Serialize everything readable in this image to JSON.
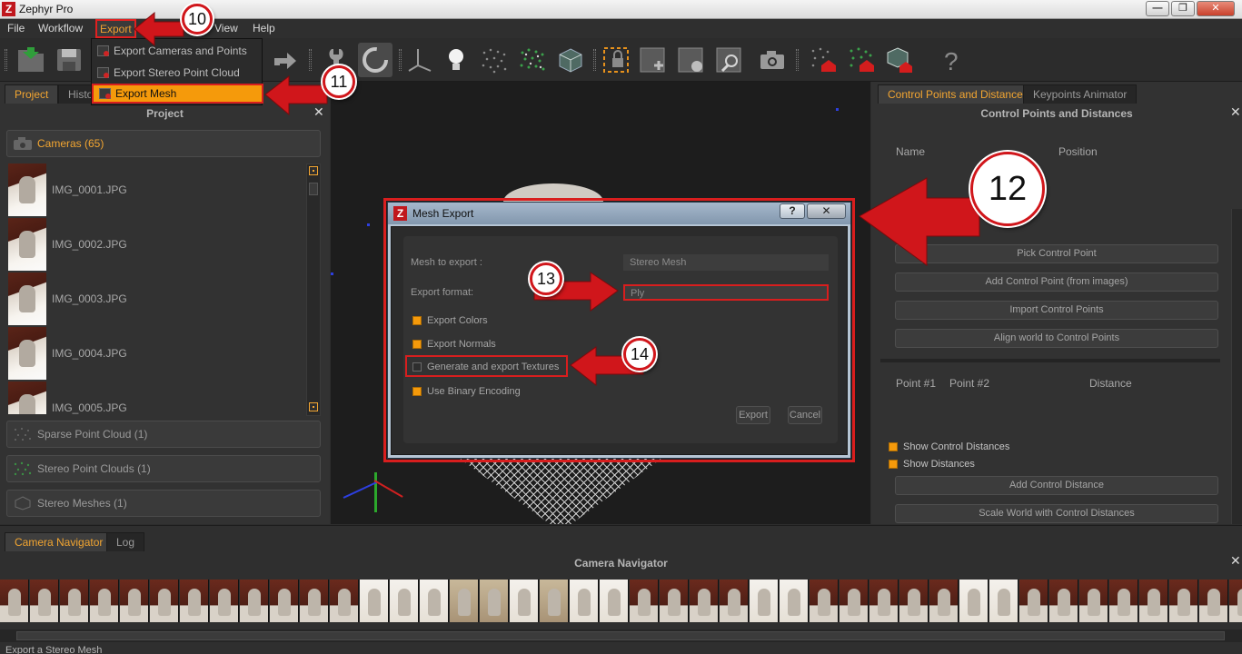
{
  "window": {
    "title": "Zephyr Pro",
    "logo_letter": "Z",
    "min_glyph": "—",
    "max_glyph": "❐",
    "close_glyph": "✕"
  },
  "menubar": {
    "items": [
      "File",
      "Workflow",
      "Export",
      "View",
      "Help"
    ]
  },
  "export_menu": {
    "items": [
      "Export Cameras and Points",
      "Export Stereo Point Cloud",
      "Export Mesh"
    ],
    "selected": "Export Mesh"
  },
  "left_panel": {
    "tabs": [
      "Project",
      "Histo"
    ],
    "title": "Project",
    "cameras_group": "Cameras (65)",
    "cameras": [
      "IMG_0001.JPG",
      "IMG_0002.JPG",
      "IMG_0003.JPG",
      "IMG_0004.JPG",
      "IMG_0005.JPG"
    ],
    "groups": [
      "Sparse Point Cloud (1)",
      "Stereo Point Clouds (1)",
      "Stereo Meshes (1)"
    ]
  },
  "right_panel": {
    "tabs": [
      "Control Points and Distances",
      "Keypoints Animator"
    ],
    "title": "Control Points and Distances",
    "col_name": "Name",
    "col_position": "Position",
    "buttons": [
      "Pick Control Point",
      "Add Control Point (from images)",
      "Import Control Points",
      "Align world to Control Points"
    ],
    "col_point1": "Point #1",
    "col_point2": "Point #2",
    "col_distance": "Distance",
    "checkboxes": [
      {
        "label": "Show Control Distances",
        "checked": true
      },
      {
        "label": "Show Distances",
        "checked": true
      }
    ],
    "bottom_buttons": [
      "Add Control Distance",
      "Scale World with Control Distances"
    ]
  },
  "dialog": {
    "title": "Mesh Export",
    "help_glyph": "?",
    "close_glyph": "✕",
    "mesh_label": "Mesh to export :",
    "mesh_value": "Stereo Mesh",
    "format_label": "Export format:",
    "format_value": "Ply",
    "options": [
      {
        "label": "Export Colors",
        "checked": true
      },
      {
        "label": "Export Normals",
        "checked": true
      },
      {
        "label": "Generate and export Textures",
        "checked": false
      },
      {
        "label": "Use Binary Encoding",
        "checked": true
      }
    ],
    "export_button": "Export",
    "cancel_button": "Cancel"
  },
  "bottom_panel": {
    "tabs": [
      "Camera Navigator",
      "Log"
    ],
    "title": "Camera Navigator"
  },
  "status": "Export a Stereo Mesh",
  "annotations": {
    "step10": "10",
    "step11": "11",
    "step12": "12",
    "step13": "13",
    "step14": "14"
  },
  "colors": {
    "accent": "#f59a0b",
    "highlight_red": "#d81e1e",
    "tab_active_text": "#f2a531",
    "background": "#2d2d2d"
  },
  "icons": [
    "open-project-icon",
    "save-icon",
    "redo-icon",
    "wrench-icon",
    "rotate-icon",
    "axis-gizmo-icon",
    "light-bulb-icon",
    "sparse-cloud-icon",
    "dense-cloud-icon",
    "mesh-cube-icon",
    "lock-frame-icon",
    "select-frame-icon",
    "select-frame-add-icon",
    "zoom-frame-icon",
    "camera-icon",
    "export-points-icon",
    "export-cloud-icon",
    "export-mesh-icon",
    "help-icon"
  ]
}
